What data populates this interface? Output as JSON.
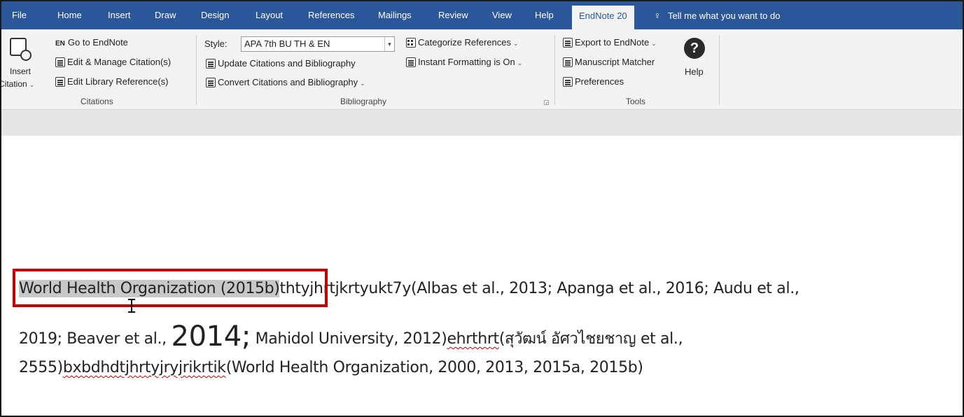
{
  "tabs": [
    "File",
    "Home",
    "Insert",
    "Draw",
    "Design",
    "Layout",
    "References",
    "Mailings",
    "Review",
    "View",
    "Help",
    "EndNote 20"
  ],
  "tell_me": "Tell me what you want to do",
  "ribbon": {
    "insert_citation": {
      "line1": "Insert",
      "line2": "Citation"
    },
    "citations": {
      "go_to_endnote": "Go to EndNote",
      "go_badge": "EN",
      "edit_manage": "Edit & Manage Citation(s)",
      "edit_library": "Edit Library Reference(s)",
      "label": "Citations"
    },
    "bibliography": {
      "style_label": "Style:",
      "style_value": "APA 7th BU TH & EN",
      "update": "Update Citations and Bibliography",
      "convert": "Convert Citations and Bibliography",
      "categorize": "Categorize References",
      "instant": "Instant Formatting is On",
      "label": "Bibliography"
    },
    "tools": {
      "export": "Export to EndNote",
      "manuscript": "Manuscript Matcher",
      "preferences": "Preferences",
      "help": "Help",
      "help_glyph": "?",
      "label": "Tools"
    }
  },
  "document": {
    "line1": {
      "selected": "World Health Organization (2015b)",
      "rest": "thtyjhrtjkrtyukt7y(Albas et al., 2013; Apanga et al., 2016; Audu et al.,"
    },
    "line2": {
      "a": "2019; Beaver et al., ",
      "big": "2014;",
      "b": " Mahidol University, 2012)",
      "squig": "ehrthrt",
      "c": "(สุวัฒน์ อัศวไชยชาญ et al.,"
    },
    "line3": {
      "a": "2555)",
      "squig": "bxbdhdtjhrtyjryjrikrtik",
      "b": "(World Health Organization, 2000, 2013, 2015a, 2015b)"
    }
  },
  "colors": {
    "accent": "#2b579a",
    "highlight_box": "#c00000",
    "selection": "#c8c8c8"
  }
}
